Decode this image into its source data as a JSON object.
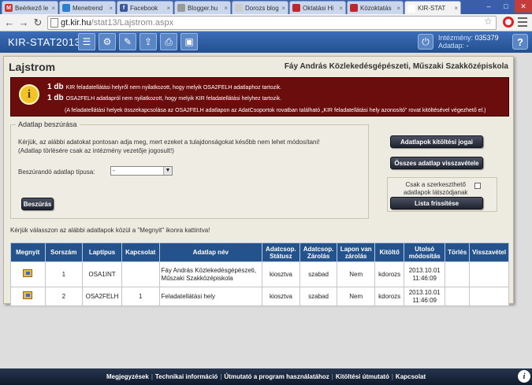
{
  "browser": {
    "tabs": [
      {
        "label": "Beérkező le",
        "fav": "M",
        "color": "#c8382c"
      },
      {
        "label": "Menetrend",
        "fav": "",
        "color": "#2a7fd4"
      },
      {
        "label": "Facebook",
        "fav": "f",
        "color": "#3b5998"
      },
      {
        "label": "Blogger.hu",
        "fav": "",
        "color": "#999999"
      },
      {
        "label": "Dorozs blog",
        "fav": "",
        "color": "#cccccc"
      },
      {
        "label": "Oktatási Hi",
        "fav": "",
        "color": "#c0272d"
      },
      {
        "label": "Közoktatás",
        "fav": "",
        "color": "#c0272d"
      },
      {
        "label": "KIR-STAT",
        "fav": "",
        "color": "#ffffff"
      }
    ],
    "url_host": "gt.kir.hu",
    "url_path": "/stat13/Lajstrom.aspx"
  },
  "app": {
    "title": "KIR-STAT2013",
    "institution_label": "Intézmény:",
    "institution_value": "035379",
    "datasheet_label": "Adatlap:",
    "datasheet_value": "-"
  },
  "page": {
    "title": "Lajstrom",
    "school": "Fáy András Közlekedésgépészeti, Műszaki Szakközépiskola"
  },
  "alert": {
    "line1_count": "1 db",
    "line1_text": "KIR feladatellátási helyről nem nyilatkozott, hogy melyik OSA2FELH adatlaphoz tartozik.",
    "line2_count": "1 db",
    "line2_text": "OSA2FELH adatlapról nem nyilatkozott, hogy melyik KIR feladatellátási helyhez tartozik.",
    "line3_text": "(A feladatellátási helyek összekapcsolása az OSA2FELH adatlapon az AdatCsoportok rovatban található „KIR feladatellátási hely azonosító\" rovat kitöltésével végezhető el.)"
  },
  "upload": {
    "legend": "Adatlap beszúrása",
    "text1": "Kérjük, az alábbi adatokat pontosan adja meg, mert ezeket a tulajdonságokat később nem lehet módosítani!",
    "text2": "(Adatlap törlésére csak az intézmény vezetője jogosult!)",
    "type_label": "Beszúrandó adatlap típusa:",
    "type_value": "-",
    "insert_button": "Beszúrás"
  },
  "side": {
    "rights_button": "Adatlapok kitöltési jogai",
    "revoke_button": "Összes adatlap visszavétele",
    "checkbox_label_1": "Csak a szerkeszthető",
    "checkbox_label_2": "adatlapok látszódjanak",
    "refresh_button": "Lista frissítése"
  },
  "hint": "Kérjük válasszon az alábbi adatlapok közül a \"Megnyit\" ikonra kattintva!",
  "table": {
    "headers": [
      "Megnyit",
      "Sorszám",
      "Laptípus",
      "Kapcsolat",
      "Adatlap név",
      "Adatcsop. Státusz",
      "Adatcsop. Zárolás",
      "Lapon van zárolás",
      "Kitöltő",
      "Utolsó módosítás",
      "Törlés",
      "Visszavétel"
    ],
    "rows": [
      {
        "num": "1",
        "type": "OSA1INT",
        "link": "",
        "name": "Fáy András Közlekedésgépészeti, Műszaki Szakközépiskola",
        "status": "kiosztva",
        "lock": "szabad",
        "pagelock": "Nem",
        "filler": "kdorozs",
        "modified": "2013.10.01 11:46:09",
        "del": "",
        "rev": ""
      },
      {
        "num": "2",
        "type": "OSA2FELH",
        "link": "1",
        "name": "Feladatellátási hely",
        "status": "kiosztva",
        "lock": "szabad",
        "pagelock": "Nem",
        "filler": "kdorozs",
        "modified": "2013.10.01 11:46:09",
        "del": "",
        "rev": ""
      }
    ]
  },
  "footer": {
    "links": [
      "Megjegyzések",
      "Technikai információ",
      "Útmutató a program használatához",
      "Kitöltési útmutató",
      "Kapcsolat"
    ]
  }
}
